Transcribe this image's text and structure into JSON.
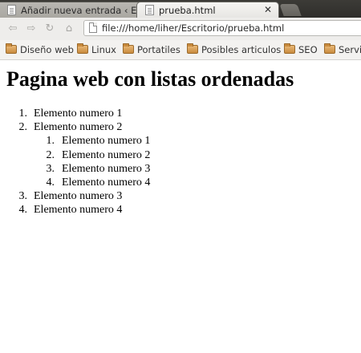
{
  "tabs": [
    {
      "title": "Añadir nueva entrada ‹ El",
      "close": "✕",
      "active": false
    },
    {
      "title": "prueba.html",
      "close": "✕",
      "active": true
    }
  ],
  "toolbar": {
    "back_icon": "arrow-left-icon",
    "forward_icon": "arrow-right-icon",
    "reload_icon": "reload-icon",
    "home_icon": "home-icon",
    "url": "file:///home/liher/Escritorio/prueba.html"
  },
  "bookmarks": [
    {
      "label": "Diseño web",
      "icon": "folder-icon"
    },
    {
      "label": "Linux",
      "icon": "folder-icon"
    },
    {
      "label": "Portatiles",
      "icon": "folder-icon"
    },
    {
      "label": "Posibles articulos",
      "icon": "folder-icon"
    },
    {
      "label": "SEO",
      "icon": "folder-icon"
    },
    {
      "label": "Servi",
      "icon": "folder-icon"
    }
  ],
  "page": {
    "heading": "Pagina web con listas ordenadas",
    "list": [
      {
        "number": "1.",
        "text": "Elemento numero 1"
      },
      {
        "number": "2.",
        "text": "Elemento numero 2",
        "children": [
          {
            "number": "1.",
            "text": "Elemento numero 1"
          },
          {
            "number": "2.",
            "text": "Elemento numero 2"
          },
          {
            "number": "3.",
            "text": "Elemento numero 3"
          },
          {
            "number": "4.",
            "text": "Elemento numero 4"
          }
        ]
      },
      {
        "number": "3.",
        "text": "Elemento numero 3"
      },
      {
        "number": "4.",
        "text": "Elemento numero 4"
      }
    ]
  },
  "colors": {
    "tabstrip": "#3c3b37",
    "toolbar": "#eeedeb",
    "page_background": "#ffffff",
    "folder": "#d9a05a"
  }
}
